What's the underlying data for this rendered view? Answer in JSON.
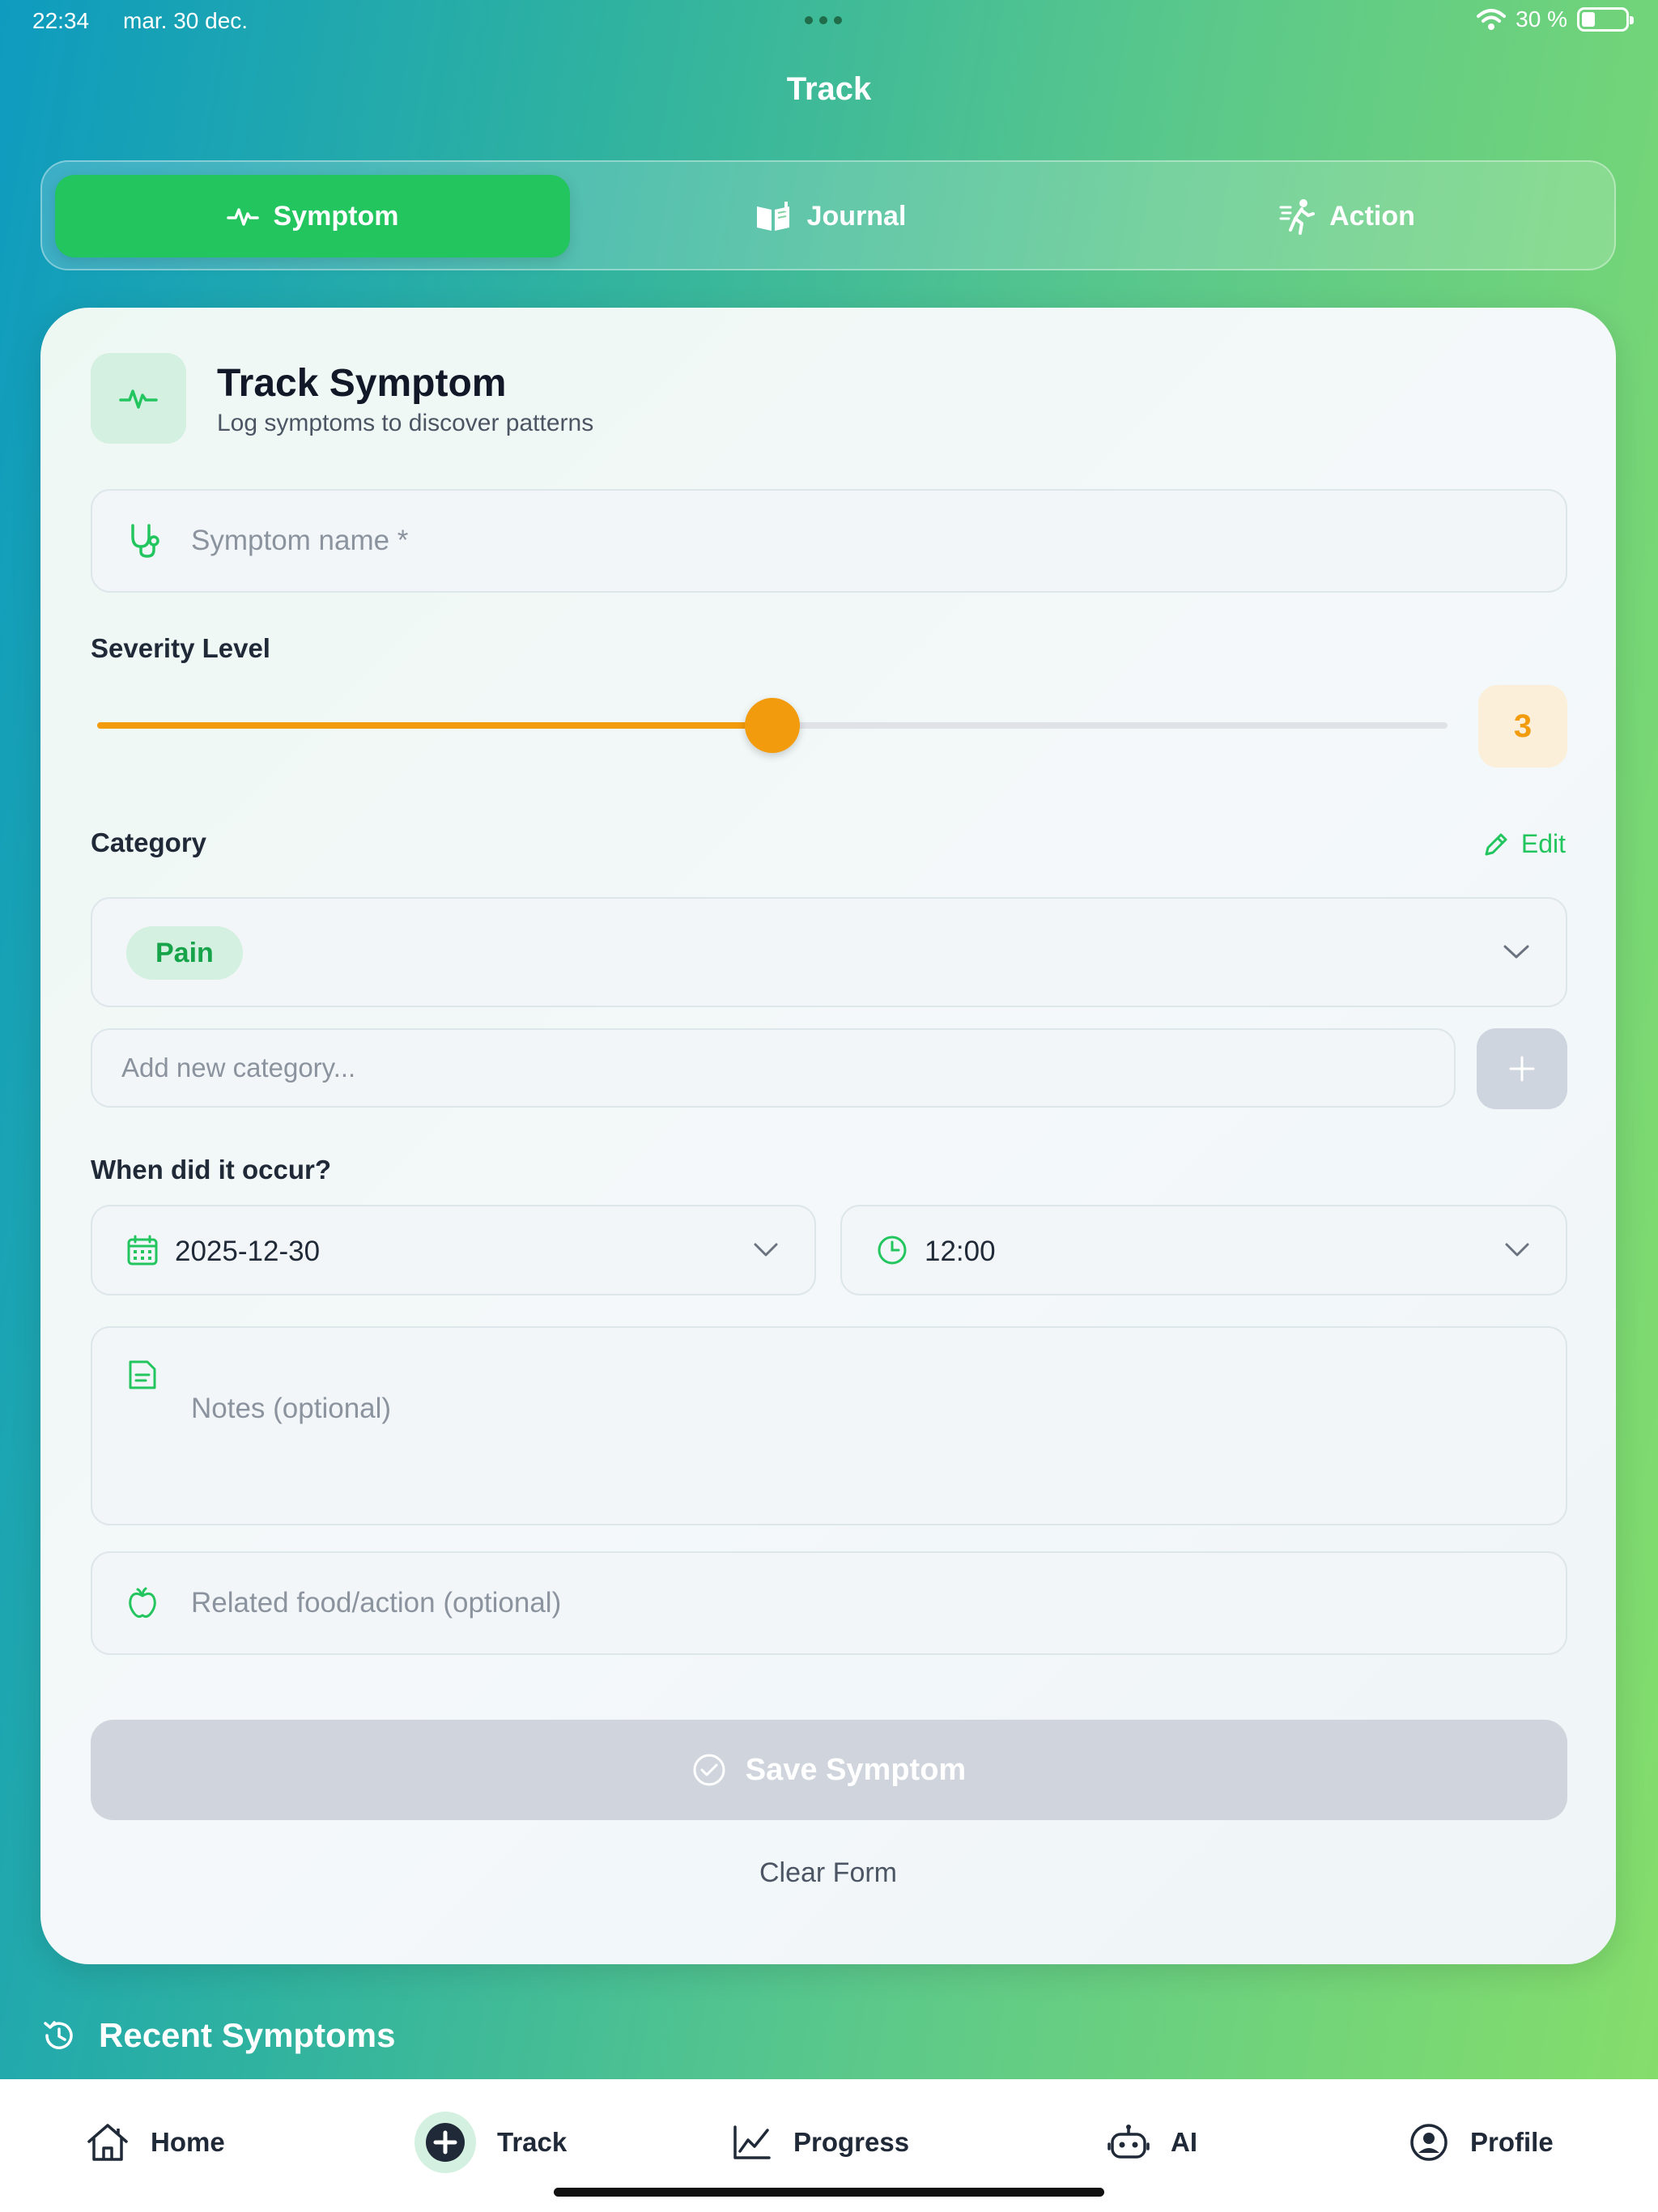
{
  "status_bar": {
    "time": "22:34",
    "date": "mar. 30 dec.",
    "battery_text": "30 %",
    "battery_level": 0.3
  },
  "header": {
    "title": "Track"
  },
  "tabs": [
    {
      "label": "Symptom",
      "icon": "activity-icon",
      "active": true
    },
    {
      "label": "Journal",
      "icon": "book-open-icon",
      "active": false
    },
    {
      "label": "Action",
      "icon": "running-icon",
      "active": false
    }
  ],
  "card": {
    "title": "Track Symptom",
    "subtitle": "Log symptoms to discover patterns",
    "symptom_name": {
      "placeholder": "Symptom name *",
      "icon": "stethoscope-icon"
    },
    "severity": {
      "label": "Severity Level",
      "value": "3",
      "min": 1,
      "max": 5,
      "accent": "#f29b0c"
    },
    "category": {
      "label": "Category",
      "edit_label": "Edit",
      "selected": "Pain",
      "new_placeholder": "Add new category..."
    },
    "occurrence": {
      "label": "When did it occur?",
      "date": "2025-12-30",
      "time": "12:00"
    },
    "notes": {
      "placeholder": "Notes (optional)",
      "icon": "note-icon"
    },
    "related": {
      "placeholder": "Related food/action (optional)",
      "icon": "apple-icon"
    },
    "save_label": "Save Symptom",
    "clear_label": "Clear Form"
  },
  "recent": {
    "title": "Recent Symptoms",
    "icon": "history-icon"
  },
  "tabbar": [
    {
      "label": "Home",
      "icon": "home-icon"
    },
    {
      "label": "Track",
      "icon": "plus-circle-icon",
      "active": true
    },
    {
      "label": "Progress",
      "icon": "chart-line-icon"
    },
    {
      "label": "AI",
      "icon": "robot-icon"
    },
    {
      "label": "Profile",
      "icon": "user-circle-icon"
    }
  ],
  "colors": {
    "accent": "#22c55e",
    "severity": "#f29b0c",
    "disabled": "#d0d5dd"
  }
}
